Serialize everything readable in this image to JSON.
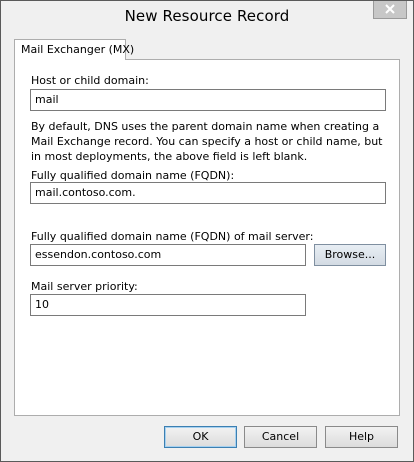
{
  "window": {
    "title": "New Resource Record"
  },
  "tab": {
    "label": "Mail Exchanger (MX)"
  },
  "form": {
    "host_label": "Host or child domain:",
    "host_value": "mail",
    "description": "By default, DNS uses the parent domain name when creating a Mail Exchange record. You can specify a host or child name, but in most deployments, the above field is left blank.",
    "fqdn_label": "Fully qualified domain name (FQDN):",
    "fqdn_value": "mail.contoso.com.",
    "mail_server_label": "Fully qualified domain name (FQDN) of mail server:",
    "mail_server_value": "essendon.contoso.com",
    "browse_label": "Browse...",
    "priority_label": "Mail server priority:",
    "priority_value": "10"
  },
  "buttons": {
    "ok": "OK",
    "cancel": "Cancel",
    "help": "Help"
  },
  "icons": {
    "close": "close-icon"
  }
}
